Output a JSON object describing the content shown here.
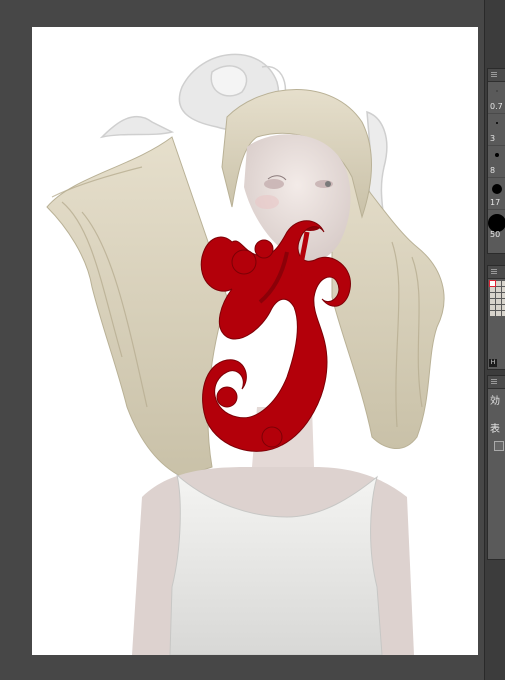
{
  "brush_sizes": {
    "items": [
      {
        "label": "0.7"
      },
      {
        "label": "3"
      },
      {
        "label": "8"
      },
      {
        "label": "17"
      },
      {
        "label": "50"
      }
    ]
  },
  "palette": {
    "badge": "H"
  },
  "effect_panel": {
    "title": "効",
    "row_label": "表"
  },
  "colors": {
    "workspace": "#474747",
    "panel_bg": "#5a5a5a",
    "blood_red": "#b3000a",
    "hair": "#d8d0b8"
  }
}
